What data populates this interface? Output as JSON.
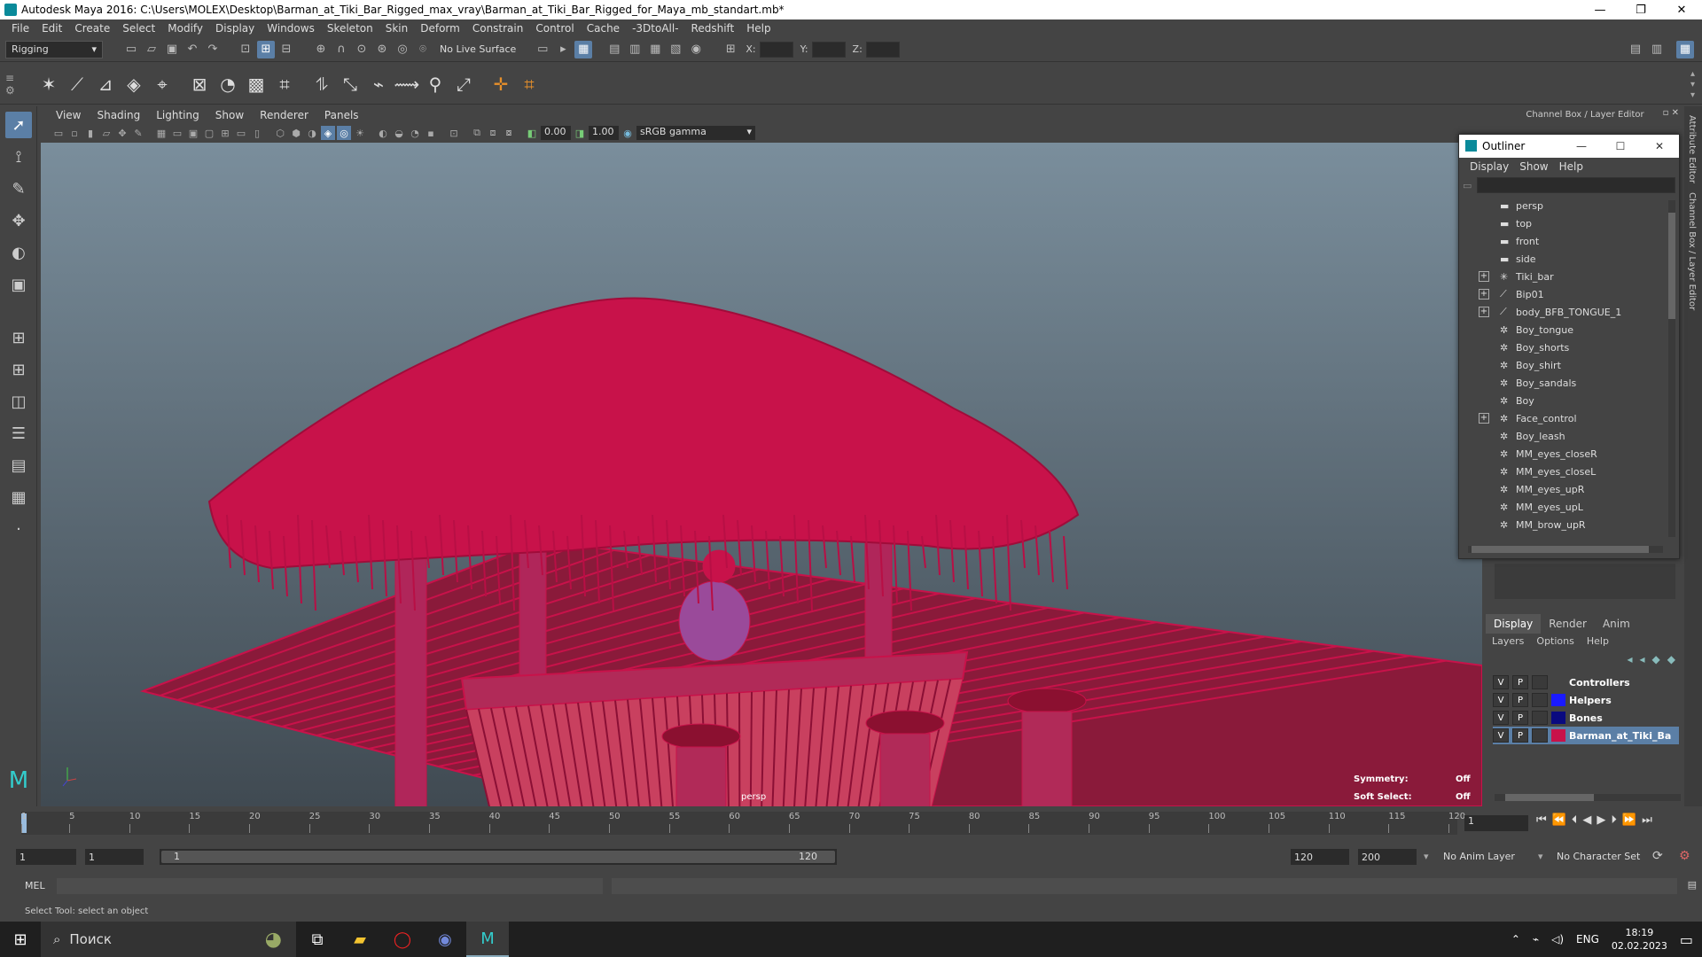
{
  "window": {
    "title": "Autodesk Maya 2016: C:\\Users\\MOLEX\\Desktop\\Barman_at_Tiki_Bar_Rigged_max_vray\\Barman_at_Tiki_Bar_Rigged_for_Maya_mb_standart.mb*",
    "minimize": "—",
    "maximize": "❐",
    "close": "✕"
  },
  "menubar": [
    "File",
    "Edit",
    "Create",
    "Select",
    "Modify",
    "Display",
    "Windows",
    "Skeleton",
    "Skin",
    "Deform",
    "Constrain",
    "Control",
    "Cache",
    "-3DtoAll-",
    "Redshift",
    "Help"
  ],
  "statusline": {
    "mode": "Rigging",
    "live_surface": "No Live Surface",
    "x_label": "X:",
    "y_label": "Y:",
    "z_label": "Z:"
  },
  "viewport": {
    "menu": [
      "View",
      "Shading",
      "Lighting",
      "Show",
      "Renderer",
      "Panels"
    ],
    "exposure": "0.00",
    "gamma": "1.00",
    "color_mgmt": "sRGB gamma",
    "camera": "persp",
    "hud": {
      "symmetry_label": "Symmetry:",
      "symmetry_value": "Off",
      "soft_select_label": "Soft Select:",
      "soft_select_value": "Off"
    },
    "wire_color": "#c8124a"
  },
  "channel_box": {
    "title": "Channel Box / Layer Editor"
  },
  "side_tabs": [
    "Attribute Editor",
    "Channel Box / Layer Editor"
  ],
  "outliner": {
    "title": "Outliner",
    "menu": [
      "Display",
      "Show",
      "Help"
    ],
    "items": [
      {
        "label": "persp",
        "icon": "camera-icon",
        "expand": ""
      },
      {
        "label": "top",
        "icon": "camera-icon",
        "expand": ""
      },
      {
        "label": "front",
        "icon": "camera-icon",
        "expand": ""
      },
      {
        "label": "side",
        "icon": "camera-icon",
        "expand": ""
      },
      {
        "label": "Tiki_bar",
        "icon": "locator-icon",
        "expand": "+"
      },
      {
        "label": "Bip01",
        "icon": "joint-icon",
        "expand": "+"
      },
      {
        "label": "body_BFB_TONGUE_1",
        "icon": "joint-icon",
        "expand": "+"
      },
      {
        "label": "Boy_tongue",
        "icon": "mesh-icon",
        "expand": ""
      },
      {
        "label": "Boy_shorts",
        "icon": "mesh-icon",
        "expand": ""
      },
      {
        "label": "Boy_shirt",
        "icon": "mesh-icon",
        "expand": ""
      },
      {
        "label": "Boy_sandals",
        "icon": "mesh-icon",
        "expand": ""
      },
      {
        "label": "Boy",
        "icon": "mesh-icon",
        "expand": ""
      },
      {
        "label": "Face_control",
        "icon": "mesh-icon",
        "expand": "+"
      },
      {
        "label": "Boy_leash",
        "icon": "mesh-icon",
        "expand": ""
      },
      {
        "label": "MM_eyes_closeR",
        "icon": "mesh-icon",
        "expand": ""
      },
      {
        "label": "MM_eyes_closeL",
        "icon": "mesh-icon",
        "expand": ""
      },
      {
        "label": "MM_eyes_upR",
        "icon": "mesh-icon",
        "expand": ""
      },
      {
        "label": "MM_eyes_upL",
        "icon": "mesh-icon",
        "expand": ""
      },
      {
        "label": "MM_brow_upR",
        "icon": "mesh-icon",
        "expand": ""
      }
    ]
  },
  "layer_editor": {
    "tabs": [
      "Display",
      "Render",
      "Anim"
    ],
    "menu": [
      "Layers",
      "Options",
      "Help"
    ],
    "layers": [
      {
        "v": "V",
        "p": "P",
        "name": "Controllers",
        "color": "#444444",
        "selected": false
      },
      {
        "v": "V",
        "p": "P",
        "name": "Helpers",
        "color": "#1a1aff",
        "selected": false
      },
      {
        "v": "V",
        "p": "P",
        "name": "Bones",
        "color": "#0a0a80",
        "selected": false
      },
      {
        "v": "V",
        "p": "P",
        "name": "Barman_at_Tiki_Bar_Rig",
        "color": "#c8124a",
        "selected": true
      }
    ]
  },
  "timeslider": {
    "ticks": [
      "1",
      "5",
      "10",
      "15",
      "20",
      "25",
      "30",
      "35",
      "40",
      "45",
      "50",
      "55",
      "60",
      "65",
      "70",
      "75",
      "80",
      "85",
      "90",
      "95",
      "100",
      "105",
      "110",
      "115",
      "120"
    ],
    "current_frame": "1"
  },
  "rangeslider": {
    "start": "1",
    "inner_start": "1",
    "bar_start": "1",
    "bar_end": "120",
    "inner_end": "120",
    "end": "200",
    "anim_layer": "No Anim Layer",
    "char_set": "No Character Set"
  },
  "cmdline": {
    "label": "MEL"
  },
  "helpline": "Select Tool: select an object",
  "taskbar": {
    "search": "Поиск",
    "lang": "ENG",
    "time": "18:19",
    "date": "02.02.2023"
  }
}
